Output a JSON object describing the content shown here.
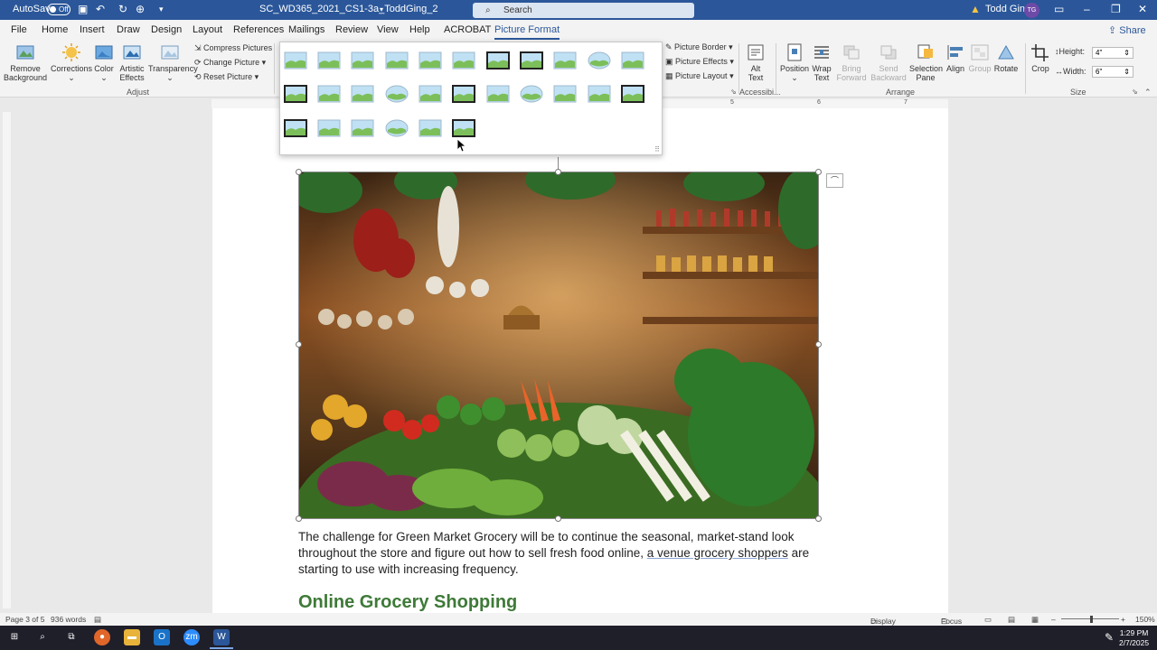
{
  "titlebar": {
    "autosave_label": "AutoSave",
    "autosave_state": "Off",
    "doc_title": "SC_WD365_2021_CS1-3a_ToddGing_2",
    "search_placeholder": "Search",
    "user_name": "Todd Ging",
    "user_initials": "TG"
  },
  "tabs": [
    "File",
    "Home",
    "Insert",
    "Draw",
    "Design",
    "Layout",
    "References",
    "Mailings",
    "Review",
    "View",
    "Help",
    "ACROBAT",
    "Picture Format"
  ],
  "share_label": "Share",
  "ribbon": {
    "remove_background": "Remove Background",
    "corrections": "Corrections",
    "color": "Color",
    "artistic_effects": "Artistic Effects",
    "transparency": "Transparency",
    "compress": "Compress Pictures",
    "change_picture": "Change Picture",
    "reset_picture": "Reset Picture",
    "adjust_group": "Adjust",
    "picture_border": "Picture Border",
    "picture_effects": "Picture Effects",
    "picture_layout": "Picture Layout",
    "alt_text": "Alt Text",
    "accessibility_group": "Accessibi...",
    "position": "Position",
    "wrap_text": "Wrap Text",
    "bring_forward": "Bring Forward",
    "send_backward": "Send Backward",
    "selection_pane": "Selection Pane",
    "align": "Align",
    "group": "Group",
    "rotate": "Rotate",
    "arrange_group": "Arrange",
    "crop": "Crop",
    "height_label": "Height:",
    "height_value": "4\"",
    "width_label": "Width:",
    "width_value": "6\"",
    "size_group": "Size"
  },
  "ruler_marks": [
    "5",
    "6",
    "7"
  ],
  "document": {
    "paragraph_start": "The challenge for Green Market Grocery will be to continue the seasonal, market-stand look throughout the store and figure out how to sell fresh food online, ",
    "paragraph_underlined": "a venue grocery shoppers",
    "paragraph_end": " are starting to use with increasing frequency.",
    "heading": "Online Grocery Shopping"
  },
  "status": {
    "page": "Page 3 of 5",
    "words": "936 words",
    "display_settings": "Display Settings",
    "focus": "Focus",
    "zoom": "150%"
  },
  "clock": {
    "time": "1:29 PM",
    "date": "2/7/2025"
  },
  "colors": {
    "accent": "#2b579a",
    "heading": "#3e7a38"
  }
}
